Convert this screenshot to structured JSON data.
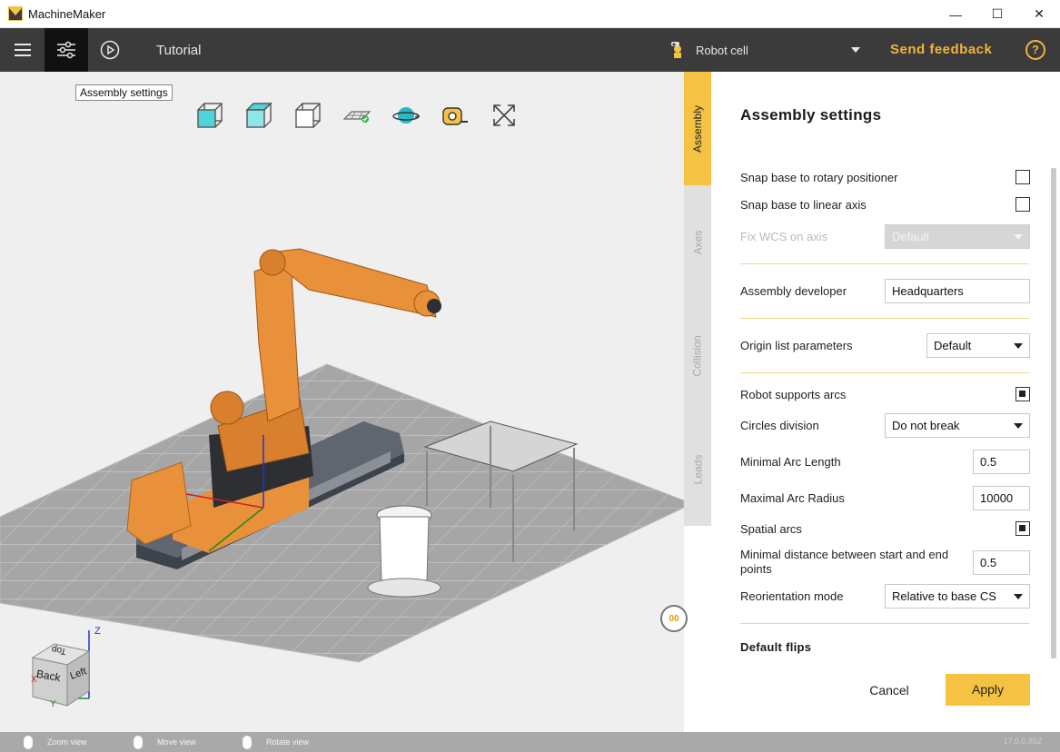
{
  "window": {
    "title": "MachineMaker",
    "minimize": "—",
    "maximize": "☐",
    "close": "✕"
  },
  "toolbar": {
    "tutorial": "Tutorial",
    "cell_selector": "Robot cell",
    "feedback": "Send feedback",
    "help": "?"
  },
  "viewport": {
    "tooltip": "Assembly settings",
    "view_icons": [
      "view-front-icon",
      "view-top-icon",
      "view-side-icon",
      "floor-icon",
      "orbit-icon",
      "measure-icon",
      "fit-view-icon"
    ],
    "cube": {
      "back": "Back",
      "left": "Left",
      "top": "Top",
      "axis_z": "Z",
      "axis_y": "Y",
      "axis_x": "X"
    },
    "timeline_button": "00"
  },
  "side_tabs": [
    {
      "label": "Assembly",
      "active": true
    },
    {
      "label": "Axes",
      "active": false
    },
    {
      "label": "Collision",
      "active": false
    },
    {
      "label": "Leads",
      "active": false
    }
  ],
  "panel": {
    "title": "Assembly settings",
    "snap_rotary": {
      "label": "Snap base to rotary positioner",
      "checked": false
    },
    "snap_linear": {
      "label": "Snap base to linear axis",
      "checked": false
    },
    "fix_wcs": {
      "label": "Fix WCS on axis",
      "value": "Default",
      "disabled": true
    },
    "developer": {
      "label": "Assembly developer",
      "value": "Headquarters"
    },
    "origin_list": {
      "label": "Origin list parameters",
      "value": "Default"
    },
    "arcs": {
      "label": "Robot supports arcs",
      "checked": true
    },
    "circles": {
      "label": "Circles division",
      "value": "Do not break"
    },
    "min_arc": {
      "label": "Minimal Arc Length",
      "value": "0.5"
    },
    "max_arc": {
      "label": "Maximal Arc Radius",
      "value": "10000"
    },
    "spatial": {
      "label": "Spatial arcs",
      "checked": true
    },
    "min_dist": {
      "label": "Minimal distance between start and end points",
      "value": "0.5"
    },
    "reorient": {
      "label": "Reorientation mode",
      "value": "Relative to base CS"
    },
    "flips": "Default flips",
    "cancel": "Cancel",
    "apply": "Apply"
  },
  "status": {
    "zoom": "Zoom view",
    "move": "Move view",
    "rotate": "Rotate view",
    "version": "17.0.0.852"
  },
  "colors": {
    "accent": "#f5c243",
    "toolbar": "#3b3b3b",
    "feedback": "#f2b33d",
    "robot": "#e8913a"
  }
}
